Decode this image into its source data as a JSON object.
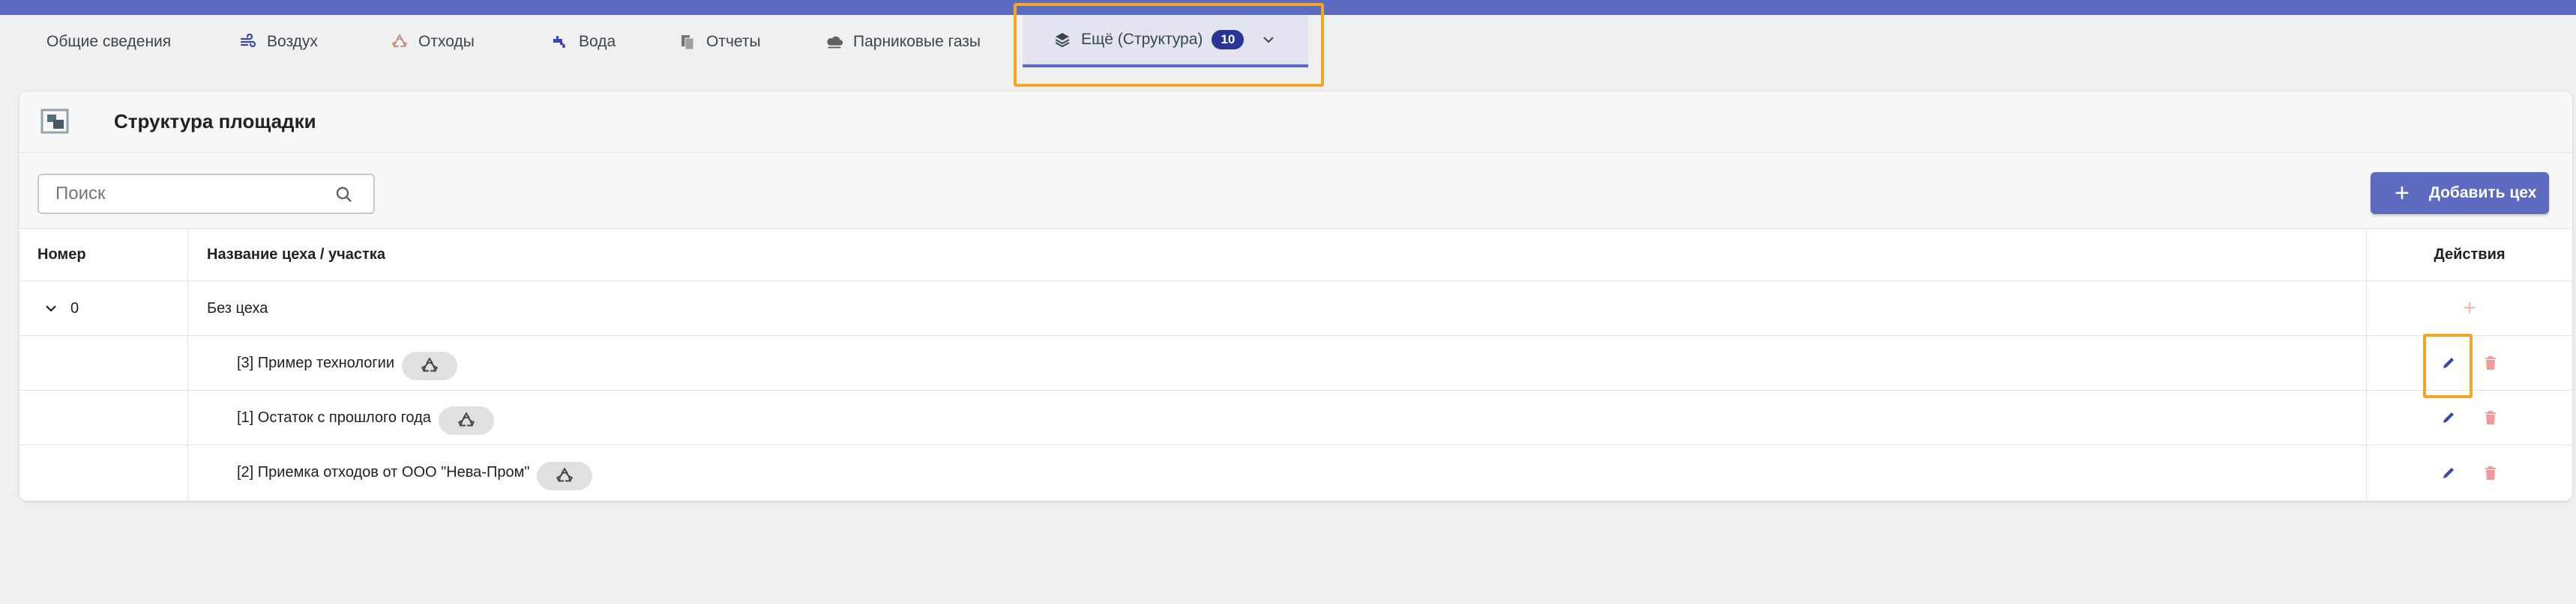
{
  "tabs": [
    {
      "label": "Общие сведения",
      "icon": "none"
    },
    {
      "label": "Воздух",
      "icon": "wind-icon"
    },
    {
      "label": "Отходы",
      "icon": "recycle-icon"
    },
    {
      "label": "Вода",
      "icon": "water-tap-icon"
    },
    {
      "label": "Отчеты",
      "icon": "documents-icon"
    },
    {
      "label": "Парниковые газы",
      "icon": "cloud-icon"
    },
    {
      "label": "Ещё (Структура)",
      "icon": "layers-icon",
      "badge": "10",
      "active": true
    }
  ],
  "panel": {
    "title": "Структура площадки",
    "search_placeholder": "Поиск",
    "add_label": "Добавить цех"
  },
  "table": {
    "headers": [
      "Номер",
      "Название цеха / участка",
      "Действия"
    ],
    "groups": [
      {
        "number": "0",
        "name": "Без цеха",
        "items": [
          {
            "name": "[3] Пример технологии",
            "icon": "recycle-icon"
          },
          {
            "name": "[1] Остаток с прошлого года",
            "icon": "recycle-icon"
          },
          {
            "name": "[2] Приемка отходов от ООО \"Нева-Пром\"",
            "icon": "recycle-icon"
          }
        ]
      }
    ]
  },
  "colors": {
    "accent": "#5c6bc0",
    "badge": "#283593",
    "highlight": "#f5a623",
    "delete": "#ef9a9a",
    "add_row": "#f4b8a8"
  }
}
